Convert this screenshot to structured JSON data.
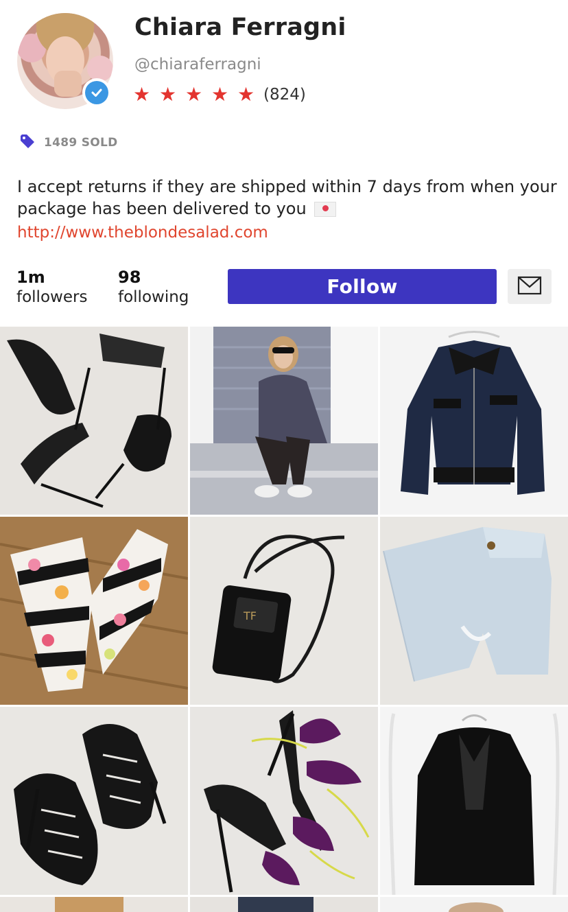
{
  "profile": {
    "name": "Chiara Ferragni",
    "handle": "@chiaraferragni",
    "rating_stars": 5,
    "review_count": "(824)",
    "sold_label": "1489 SOLD",
    "bio": "I accept returns if they are shipped within 7 days from when your package has been delivered to you",
    "bio_emoji_icon": "love-letter-icon",
    "website": "http://www.theblondesalad.com",
    "avatar_icon": "profile-photo",
    "verified_icon": "verified-check-icon"
  },
  "stats": {
    "followers_num": "1m",
    "followers_label": "followers",
    "following_num": "98",
    "following_label": "following"
  },
  "actions": {
    "follow_label": "Follow",
    "message_icon": "mail-icon"
  },
  "colors": {
    "accent": "#3d35c0",
    "star": "#e3342f",
    "link": "#e0452e",
    "verified": "#3b97e3",
    "tag": "#4a3fd1"
  },
  "listings": [
    {
      "item": "black braided stiletto sandals"
    },
    {
      "item": "person sitting on steps in sweater"
    },
    {
      "item": "navy suede leather biker jacket"
    },
    {
      "item": "floral striped trousers"
    },
    {
      "item": "black leather phone crossbody bag"
    },
    {
      "item": "light wash distressed jeans"
    },
    {
      "item": "black cutout heeled booties"
    },
    {
      "item": "feather embellished heeled sandals"
    },
    {
      "item": "black shaggy fur vest"
    }
  ]
}
